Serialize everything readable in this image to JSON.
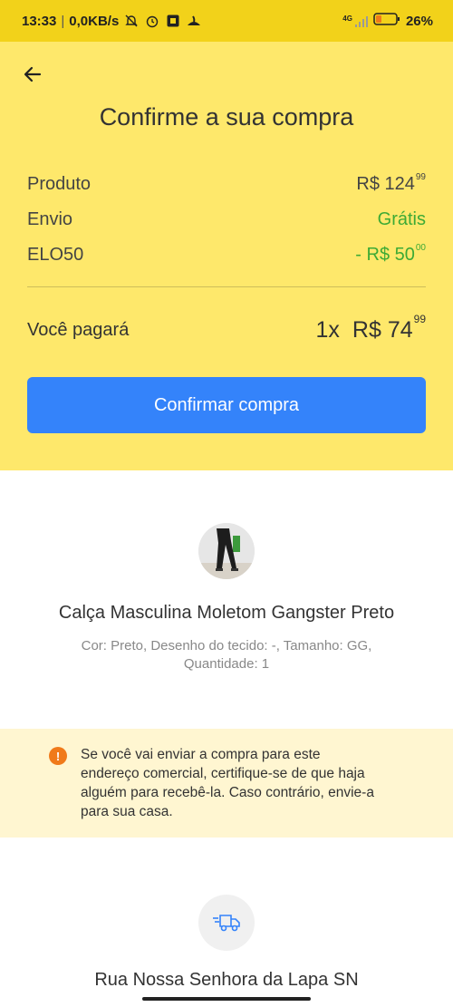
{
  "status_bar": {
    "time": "13:33",
    "speed": "0,0KB/s",
    "network": "4G",
    "battery": "26%"
  },
  "header": {
    "title": "Confirme a sua compra"
  },
  "summary": {
    "product_label": "Produto",
    "product_price_main": "R$ 124",
    "product_price_cents": "99",
    "shipping_label": "Envio",
    "shipping_value": "Grátis",
    "coupon_label": "ELO50",
    "coupon_main": "- R$ 50",
    "coupon_cents": "00"
  },
  "total": {
    "label": "Você pagará",
    "quantity": "1x",
    "value_main": "R$ 74",
    "value_cents": "99"
  },
  "confirm_button": "Confirmar compra",
  "product": {
    "title": "Calça Masculina Moletom Gangster Preto",
    "attributes": "Cor: Preto, Desenho do tecido: -, Tamanho: GG, Quantidade: 1"
  },
  "notice": {
    "icon": "!",
    "text": "Se você vai enviar a compra para este endereço comercial, certifique-se de que haja alguém para recebê-la. Caso contrário, envie-a para sua casa."
  },
  "shipping": {
    "address": "Rua Nossa Senhora da Lapa SN"
  },
  "colors": {
    "status_bar": "#f2d21a",
    "header_bg": "#fee86b",
    "button": "#3483fa",
    "green": "#3daa35",
    "notice_bg": "#fff6d1",
    "warning": "#f07a1a"
  }
}
